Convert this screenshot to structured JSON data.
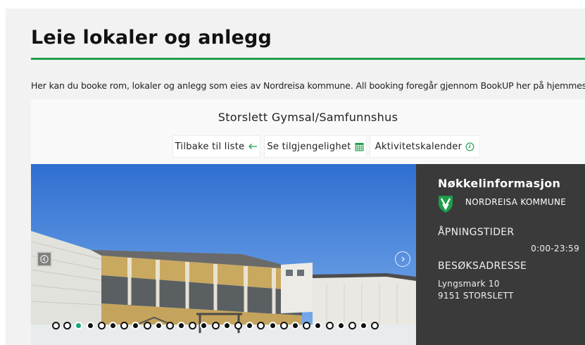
{
  "page": {
    "title": "Leie lokaler og anlegg",
    "intro": "Her kan du booke rom, lokaler og anlegg som eies av Nordreisa kommune. All booking foregår gjennom BookUP her på hjemmesiden."
  },
  "venue": {
    "name": "Storslett Gymsal/Samfunnshus"
  },
  "actions": {
    "back_label": "Tilbake til liste",
    "back_icon": "arrow-left-icon",
    "availability_label": "Se tilgjengelighet",
    "availability_icon": "calendar-grid-icon",
    "calendar_label": "Aktivitetskalender",
    "calendar_icon": "clock-icon"
  },
  "gallery": {
    "slide_count": 29,
    "active_index": 2,
    "prev_icon": "chevron-left-icon",
    "next_icon": "chevron-right-icon"
  },
  "info": {
    "heading": "Nøkkelinformasjon",
    "org_name": "NORDREISA KOMMUNE",
    "org_logo": "municipality-shield-icon",
    "hours_label": "ÅPNINGSTIDER",
    "hours_value": "0:00-23:59",
    "address_label": "BESØKSADRESSE",
    "address_line1": "Lyngsmark 10",
    "address_line2": "9151 STORSLETT"
  },
  "colors": {
    "accent_green": "#1e9e4a",
    "active_dot": "#1aa37a",
    "info_panel": "#3a3a3a",
    "page_bg": "#f2f2f2"
  }
}
